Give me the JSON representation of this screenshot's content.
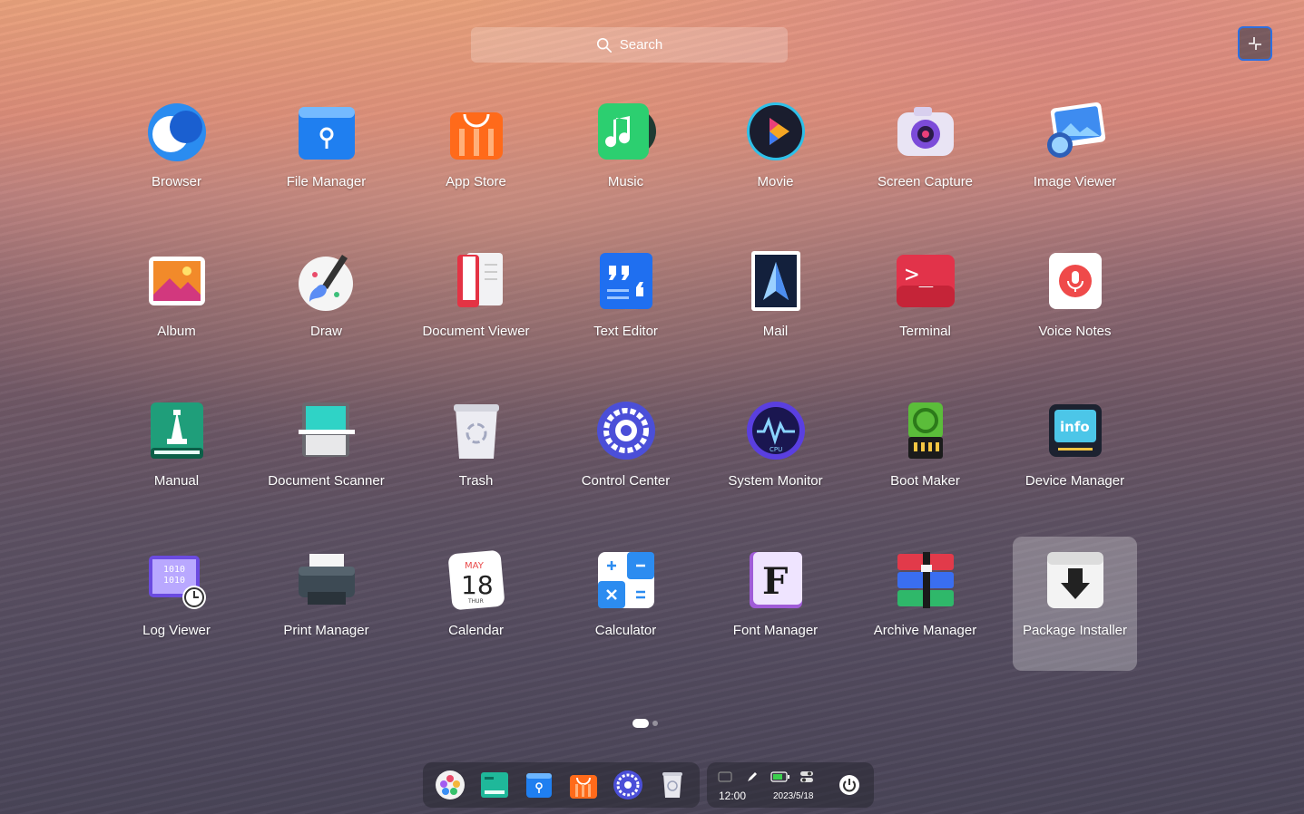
{
  "search": {
    "placeholder": "Search",
    "icon": "search-icon"
  },
  "collapse_button": {
    "icon": "collapse-icon"
  },
  "apps": [
    {
      "label": "Browser",
      "icon": "browser"
    },
    {
      "label": "File Manager",
      "icon": "file-manager"
    },
    {
      "label": "App Store",
      "icon": "app-store"
    },
    {
      "label": "Music",
      "icon": "music"
    },
    {
      "label": "Movie",
      "icon": "movie"
    },
    {
      "label": "Screen Capture",
      "icon": "screen-capture"
    },
    {
      "label": "Image Viewer",
      "icon": "image-viewer"
    },
    {
      "label": "Album",
      "icon": "album"
    },
    {
      "label": "Draw",
      "icon": "draw"
    },
    {
      "label": "Document Viewer",
      "icon": "document-viewer"
    },
    {
      "label": "Text Editor",
      "icon": "text-editor"
    },
    {
      "label": "Mail",
      "icon": "mail"
    },
    {
      "label": "Terminal",
      "icon": "terminal"
    },
    {
      "label": "Voice Notes",
      "icon": "voice-notes"
    },
    {
      "label": "Manual",
      "icon": "manual"
    },
    {
      "label": "Document Scanner",
      "icon": "document-scanner"
    },
    {
      "label": "Trash",
      "icon": "trash"
    },
    {
      "label": "Control Center",
      "icon": "control-center"
    },
    {
      "label": "System Monitor",
      "icon": "system-monitor"
    },
    {
      "label": "Boot Maker",
      "icon": "boot-maker"
    },
    {
      "label": "Device Manager",
      "icon": "device-manager"
    },
    {
      "label": "Log Viewer",
      "icon": "log-viewer"
    },
    {
      "label": "Print Manager",
      "icon": "print-manager"
    },
    {
      "label": "Calendar",
      "icon": "calendar"
    },
    {
      "label": "Calculator",
      "icon": "calculator"
    },
    {
      "label": "Font Manager",
      "icon": "font-manager"
    },
    {
      "label": "Archive Manager",
      "icon": "archive-manager"
    },
    {
      "label": "Package Installer",
      "icon": "package-installer",
      "selected": true
    }
  ],
  "icon_text": {
    "calendar_month": "MAY",
    "calendar_day": "18",
    "calendar_weekday": "THUR",
    "device_manager_info": "info",
    "font_manager_letter": "F",
    "terminal_prompt": ">_",
    "system_monitor_cpu": "CPU",
    "log_viewer_bits": "1010"
  },
  "pager": {
    "pages": 2,
    "current": 1
  },
  "dock": {
    "items": [
      {
        "name": "launcher",
        "icon": "launcher-icon"
      },
      {
        "name": "multitasking",
        "icon": "multitasking-icon"
      },
      {
        "name": "file-manager",
        "icon": "file-manager-icon"
      },
      {
        "name": "app-store",
        "icon": "app-store-icon"
      },
      {
        "name": "control-center",
        "icon": "control-center-icon"
      },
      {
        "name": "trash",
        "icon": "trash-icon"
      }
    ]
  },
  "tray": {
    "time": "12:00",
    "date": "2023/5/18",
    "icons": [
      "keyboard-icon",
      "pen-icon",
      "battery-icon",
      "toggle-icon",
      "power-icon"
    ]
  },
  "colors": {
    "accent": "#2d6fe0",
    "selection": "rgba(255,255,255,0.28)"
  }
}
